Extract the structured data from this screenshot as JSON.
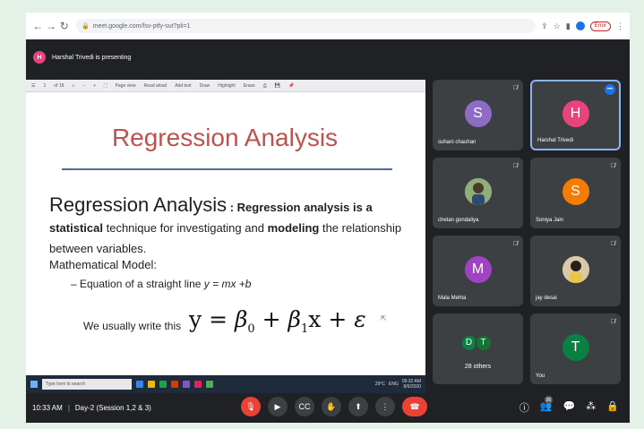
{
  "browser": {
    "url": "meet.google.com/fsv-ptfy-sut?pli=1",
    "error_label": "Error"
  },
  "presenting": {
    "initial": "H",
    "text": "Harshal Trivedi is presenting"
  },
  "doc_toolbar": {
    "items": [
      "1",
      "of 18",
      "Page view",
      "Read aloud",
      "Add text",
      "Draw",
      "Highlight",
      "Erase"
    ]
  },
  "slide": {
    "title": "Regression Analysis",
    "heading_term": "Regression Analysis",
    "colon": " : ",
    "bold_phrase": "Regression analysis is a statistical",
    "text_1": " technique for investigating and ",
    "bold_word": "modeling",
    "text_2": " the relationship between variables.",
    "model_label": "Mathematical Model:",
    "model_prefix": "– Equation of a straight line ",
    "model_equation": "y = mx +b",
    "write_this": "We usually write this",
    "formula_parts": {
      "y": "y = ",
      "b0": "β",
      "s0": "0",
      "plus1": " + ",
      "b1": "β",
      "s1": "1",
      "x": "x + ",
      "eps": "ε"
    }
  },
  "taskbar": {
    "search_placeholder": "Type here to search",
    "temp": "29°C",
    "lang": "ENG",
    "time": "09:32 AM",
    "date": "8/6/2020"
  },
  "participants": [
    {
      "name": "suhani chauhan",
      "initial": "S",
      "color": "#8c6cc4",
      "muted": true
    },
    {
      "name": "Harshal Trivedi",
      "initial": "H",
      "color": "#e8437b",
      "active": true
    },
    {
      "name": "chetan gondaliya",
      "photo": true,
      "muted": true
    },
    {
      "name": "Soniya Jain",
      "initial": "S",
      "color": "#f57c00",
      "muted": true
    },
    {
      "name": "Mala Mehta",
      "initial": "M",
      "color": "#a142c5",
      "muted": true
    },
    {
      "name": "jay desai",
      "photo": true,
      "muted": true
    },
    {
      "name": "28 others",
      "others": [
        "D",
        "T"
      ]
    },
    {
      "name": "You",
      "initial": "T",
      "color": "#0b8043",
      "muted": true
    }
  ],
  "meeting": {
    "time": "10:33 AM",
    "title": "Day-2 (Session 1,2 & 3)",
    "people_count": "36"
  }
}
